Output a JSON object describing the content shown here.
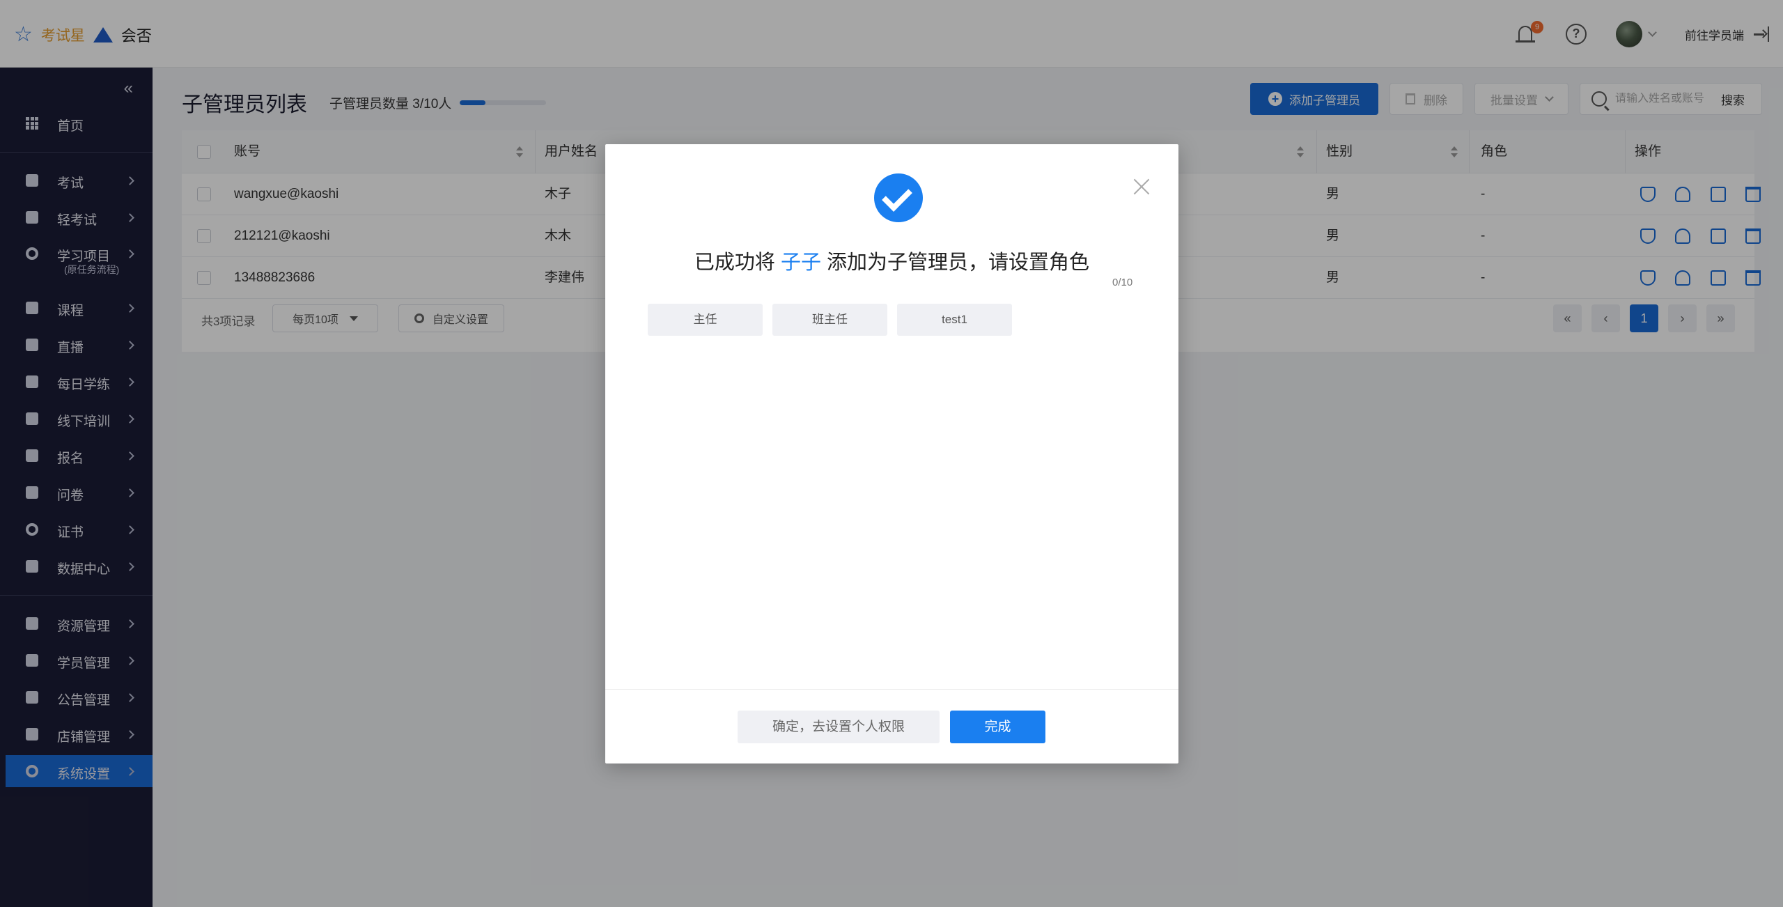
{
  "header": {
    "brand_exam": "考试星",
    "brand_partner": "会否",
    "notification_count": "9",
    "goto_student": "前往学员端"
  },
  "sidebar": {
    "items": [
      {
        "label": "首页",
        "icon": "grid-icon"
      },
      {
        "label": "考试",
        "icon": "exam-icon"
      },
      {
        "label": "轻考试",
        "icon": "quick-exam-icon"
      },
      {
        "label": "学习项目",
        "sub": "(原任务流程)",
        "icon": "project-icon"
      },
      {
        "label": "课程",
        "icon": "book-icon"
      },
      {
        "label": "直播",
        "icon": "live-icon"
      },
      {
        "label": "每日学练",
        "icon": "calendar-icon"
      },
      {
        "label": "线下培训",
        "icon": "training-icon"
      },
      {
        "label": "报名",
        "icon": "signup-icon"
      },
      {
        "label": "问卷",
        "icon": "survey-icon"
      },
      {
        "label": "证书",
        "icon": "certificate-icon"
      },
      {
        "label": "数据中心",
        "icon": "chart-icon"
      },
      {
        "label": "资源管理",
        "icon": "folder-icon"
      },
      {
        "label": "学员管理",
        "icon": "student-icon"
      },
      {
        "label": "公告管理",
        "icon": "announcement-icon"
      },
      {
        "label": "店铺管理",
        "icon": "store-icon"
      },
      {
        "label": "系统设置",
        "icon": "gear-icon",
        "active": true
      }
    ]
  },
  "main": {
    "title": "子管理员列表",
    "count_label": "子管理员数量 3/10人",
    "count_progress": 0.3,
    "add_button": "添加子管理员",
    "delete_button": "删除",
    "batch_button": "批量设置",
    "search_placeholder": "请输入姓名或账号",
    "search_button": "搜索",
    "columns": [
      "账号",
      "用户姓名",
      "性别",
      "角色",
      "操作"
    ],
    "rows": [
      {
        "account": "wangxue@kaoshi",
        "name": "木子",
        "gender": "男",
        "role": "-"
      },
      {
        "account": "212121@kaoshi",
        "name": "木木",
        "gender": "男",
        "role": "-"
      },
      {
        "account": "13488823686",
        "name": "李建伟",
        "gender": "男",
        "role": "-"
      }
    ],
    "total": "共3项记录",
    "page_size": "每页10项",
    "custom_settings": "自定义设置",
    "current_page": "1"
  },
  "modal": {
    "msg_prefix": "已成功将 ",
    "msg_name": "子子",
    "msg_suffix": " 添加为子管理员，请设置角色",
    "counter": "0/10",
    "roles": [
      "主任",
      "班主任",
      "test1"
    ],
    "secondary_button": "确定，去设置个人权限",
    "primary_button": "完成"
  },
  "colors": {
    "primary": "#1a6bd6",
    "sidebar_bg": "#1b1d36",
    "badge": "#f26b2e"
  }
}
